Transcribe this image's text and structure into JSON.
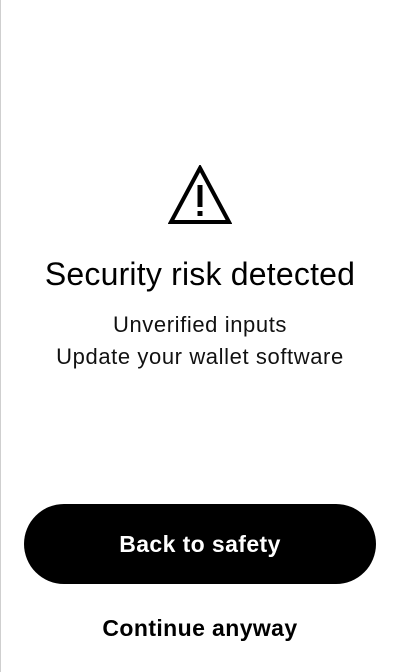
{
  "warning": {
    "icon": "warning-triangle-icon",
    "title": "Security risk detected",
    "messages": [
      "Unverified inputs",
      "Update your wallet software"
    ]
  },
  "actions": {
    "primary_label": "Back to safety",
    "secondary_label": "Continue anyway"
  },
  "colors": {
    "background": "#ffffff",
    "primary_button_bg": "#000000",
    "primary_button_text": "#ffffff",
    "text": "#000000"
  }
}
